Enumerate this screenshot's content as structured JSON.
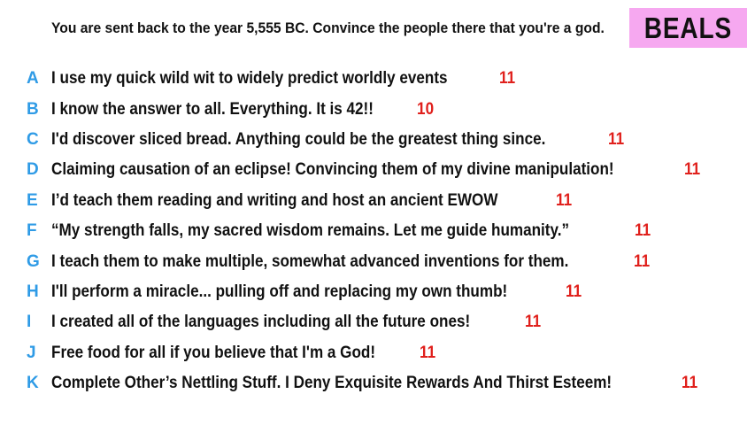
{
  "prompt": "You are sent back to the year 5,555 BC. Convince the people there that you're a god.",
  "player_name": "BEALS",
  "colors": {
    "letter": "#2f9be6",
    "score": "#e0201c",
    "name_box": "#f6a8f0"
  },
  "answers": [
    {
      "letter": "A",
      "text": "I use my quick wild wit to widely predict worldly events",
      "score": "11"
    },
    {
      "letter": "B",
      "text": "I know the answer to all. Everything. It is 42!!",
      "score": "10"
    },
    {
      "letter": "C",
      "text": "I'd discover sliced bread. Anything could be the greatest thing since.",
      "score": "11"
    },
    {
      "letter": "D",
      "text": "Claiming causation of an eclipse! Convincing them of my divine manipulation!",
      "score": "11"
    },
    {
      "letter": "E",
      "text": "I’d teach them reading and writing and host an ancient EWOW",
      "score": "11"
    },
    {
      "letter": "F",
      "text": "“My strength falls, my sacred wisdom remains. Let me guide humanity.”",
      "score": "11"
    },
    {
      "letter": "G",
      "text": "I teach them to make multiple, somewhat advanced inventions for them.",
      "score": "11"
    },
    {
      "letter": "H",
      "text": "I'll perform a miracle... pulling off and replacing my own thumb!",
      "score": "11"
    },
    {
      "letter": "I",
      "text": "I created all of the languages including all the future ones!",
      "score": "11"
    },
    {
      "letter": "J",
      "text": "Free food for all if you believe that I'm a God!",
      "score": "11"
    },
    {
      "letter": "K",
      "text": "Complete Other’s Nettling Stuff. I Deny Exquisite Rewards And Thirst Esteem!",
      "score": "11"
    }
  ]
}
